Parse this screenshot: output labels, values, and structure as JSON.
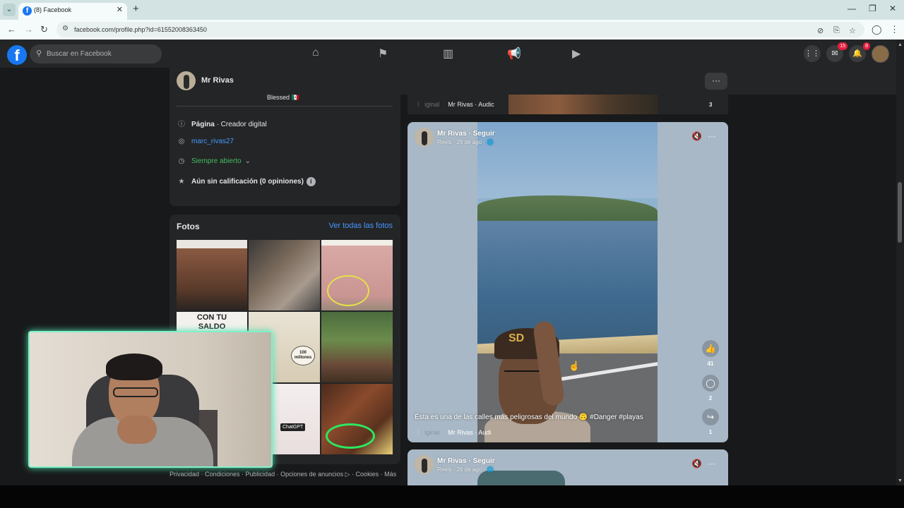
{
  "browser": {
    "tab_title": "(8) Facebook",
    "url": "facebook.com/profile.php?id=61552008363450"
  },
  "header": {
    "search_placeholder": "Buscar en Facebook",
    "messenger_badge": "15",
    "notifications_badge": "8"
  },
  "profile": {
    "name": "Mr Rivas"
  },
  "intro": {
    "blessed": "Blessed 🇲🇽",
    "page_label": "Página",
    "page_category": " · Creador digital",
    "instagram": "marc_rivas27",
    "hours": "Siempre abierto",
    "rating": "Aún sin calificación (0 opiniones)"
  },
  "photos": {
    "title": "Fotos",
    "see_all": "Ver todas las fotos",
    "saldo_text": "CON TU SALDO BANCARIO",
    "millones": "100 millones",
    "chatgpt": "ChatGPT"
  },
  "footer": {
    "links": "Privacidad · Condiciones · Publicidad · Opciones de anuncios ▷ · Cookies · Más"
  },
  "strip": {
    "audio_faded": "iginal",
    "audio": "Mr Rivas · Audic",
    "count": "3"
  },
  "post": {
    "author": "Mr Rivas · Seguir",
    "meta": "Reels · 26 de ago · 🌐",
    "likes": "41",
    "comments": "2",
    "shares": "1",
    "caption": "Ésta es una de las calles más peligrosas del mundo 🙃 #Danger #playas",
    "audio_faded": "iginal",
    "audio": "Mr Rivas · Audi"
  },
  "post2": {
    "author": "Mr Rivas · Seguir",
    "meta": "Reels · 26 de ago · 🌐"
  }
}
